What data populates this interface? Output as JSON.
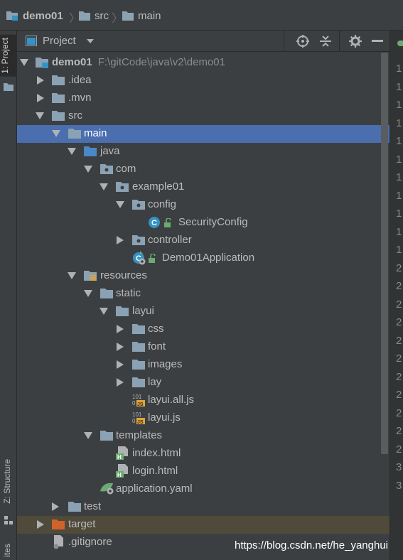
{
  "breadcrumb": {
    "project": "demo01",
    "folder1": "src",
    "folder2": "main"
  },
  "left_tabs": {
    "project": "1: Project",
    "structure": "Z: Structure",
    "favorites": "ites"
  },
  "panel": {
    "title": "Project"
  },
  "tree": {
    "items": [
      {
        "label": "demo01",
        "path": "F:\\gitCode\\java\\v2\\demo01"
      },
      {
        "label": ".idea"
      },
      {
        "label": ".mvn"
      },
      {
        "label": "src"
      },
      {
        "label": "main"
      },
      {
        "label": "java"
      },
      {
        "label": "com"
      },
      {
        "label": "example01"
      },
      {
        "label": "config"
      },
      {
        "label": "SecurityConfig"
      },
      {
        "label": "controller"
      },
      {
        "label": "Demo01Application"
      },
      {
        "label": "resources"
      },
      {
        "label": "static"
      },
      {
        "label": "layui"
      },
      {
        "label": "css"
      },
      {
        "label": "font"
      },
      {
        "label": "images"
      },
      {
        "label": "lay"
      },
      {
        "label": "layui.all.js"
      },
      {
        "label": "layui.js"
      },
      {
        "label": "templates"
      },
      {
        "label": "index.html"
      },
      {
        "label": "login.html"
      },
      {
        "label": "application.yaml"
      },
      {
        "label": "test"
      },
      {
        "label": "target"
      },
      {
        "label": ".gitignore"
      }
    ]
  },
  "gutter": {
    "lines": [
      "1",
      "1",
      "1",
      "1",
      "1",
      "1",
      "1",
      "1",
      "1",
      "1",
      "1",
      "2",
      "2",
      "2",
      "2",
      "2",
      "2",
      "2",
      "2",
      "2",
      "2",
      "2",
      "3",
      "3"
    ]
  },
  "watermark": "https://blog.csdn.net/he_yanghui",
  "colors": {
    "background": "#3c3f41",
    "selection": "#4b6eaf",
    "folder": "#8ba2b4",
    "source_folder": "#4a88c7",
    "excluded_folder": "#d0622c",
    "class_icon": "#3592c4",
    "spring": "#6aab73"
  }
}
